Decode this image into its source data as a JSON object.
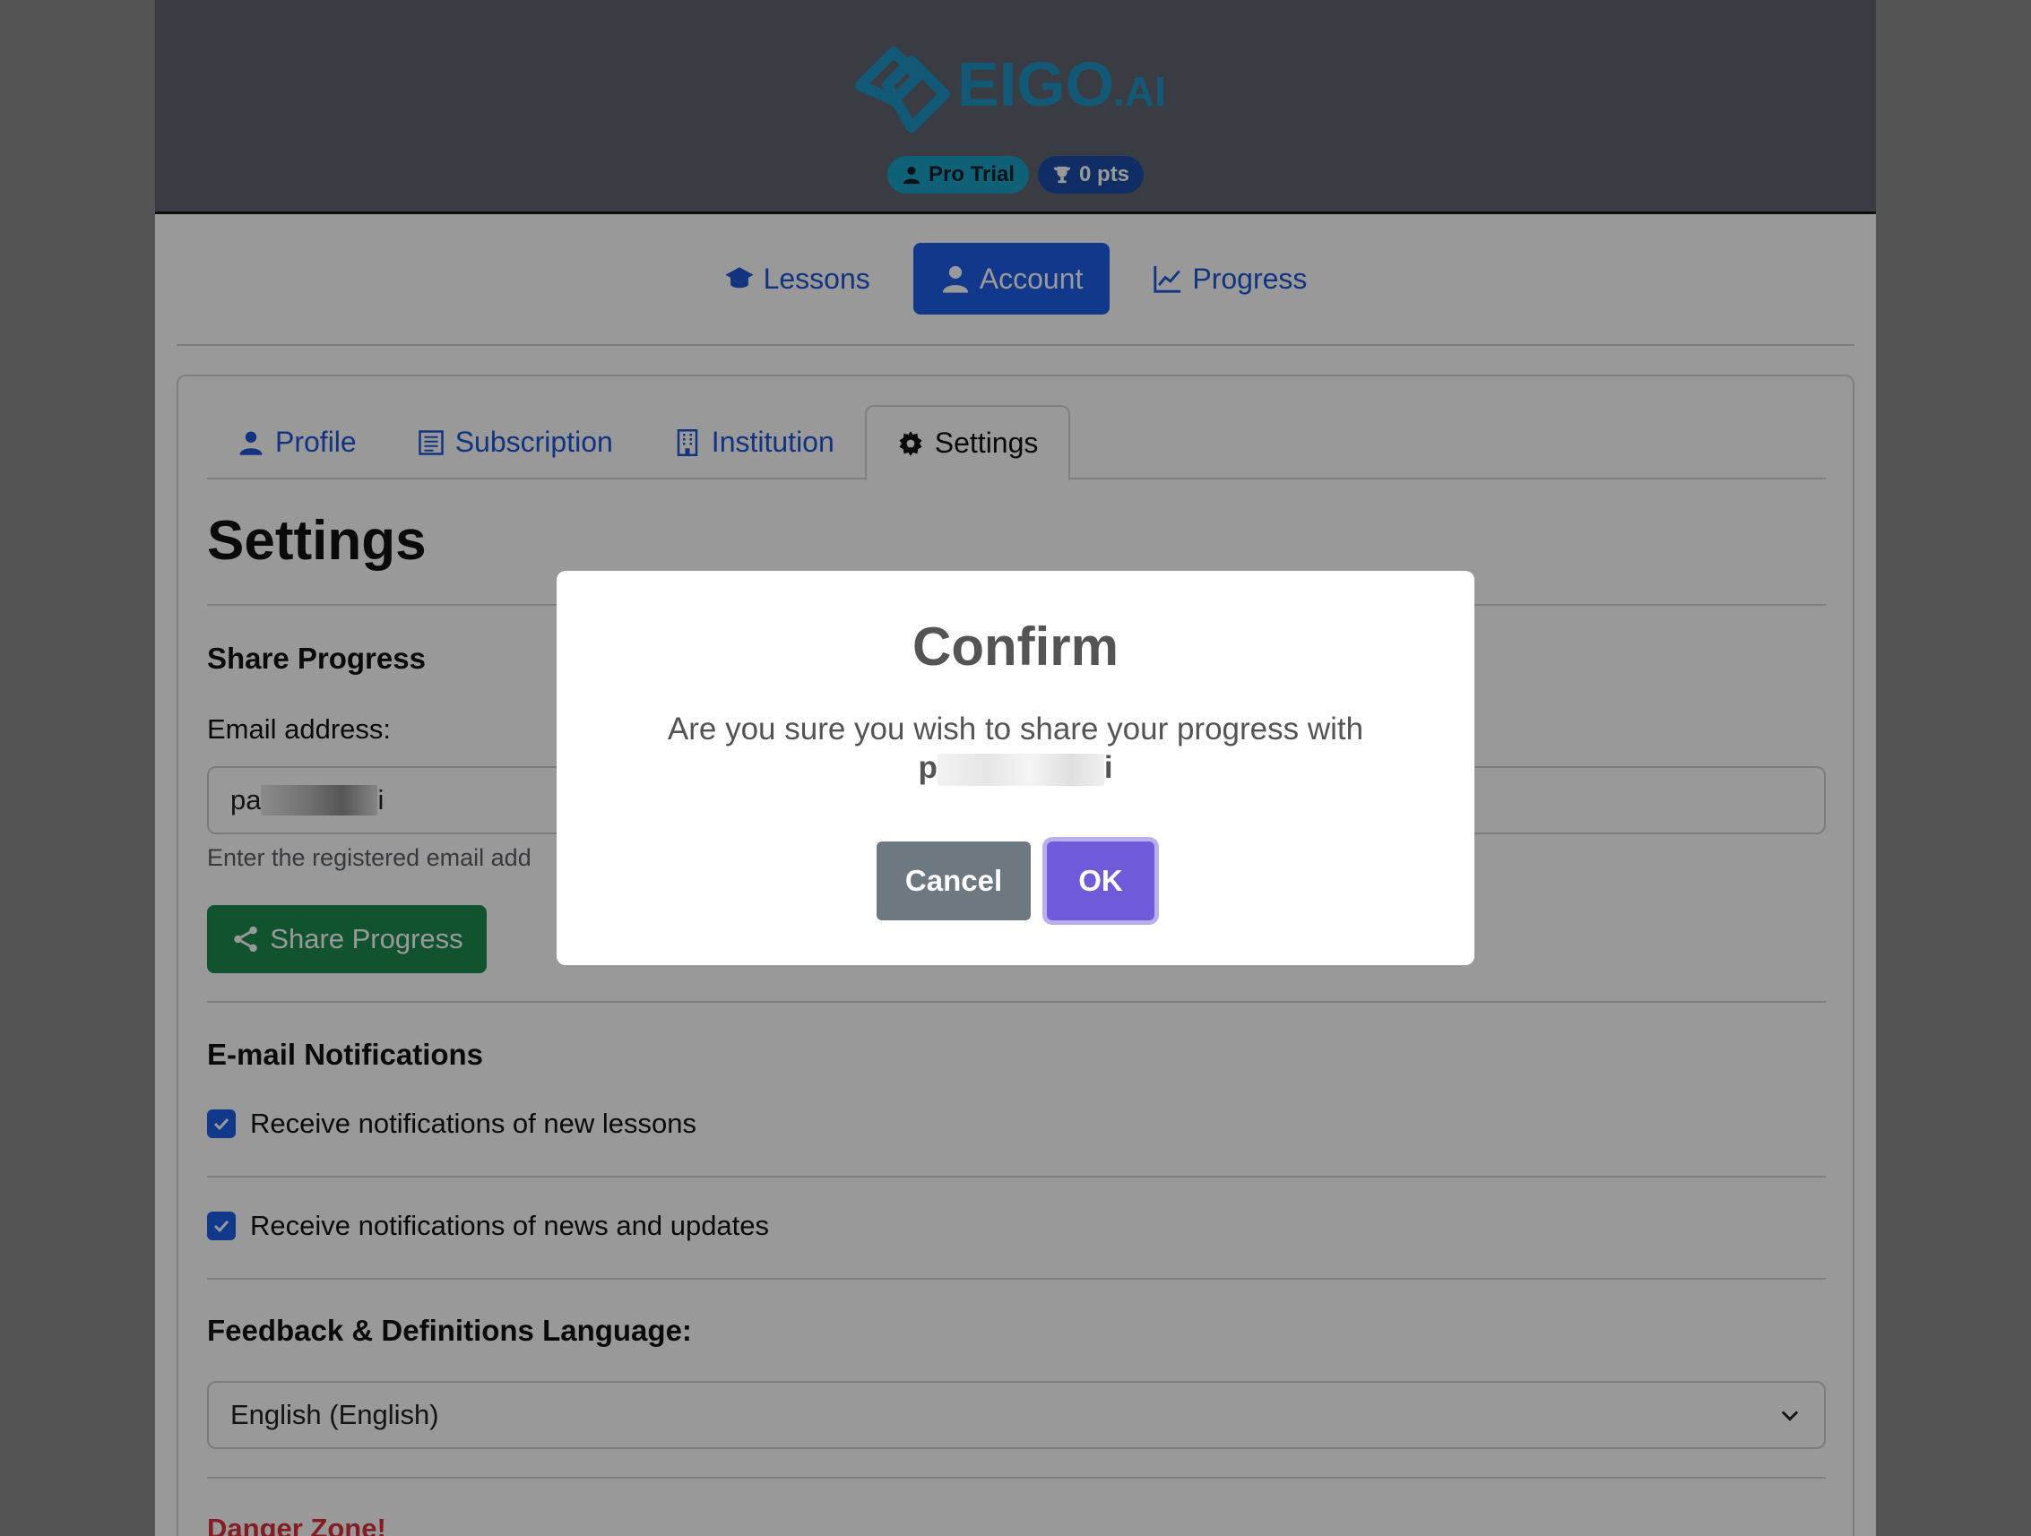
{
  "header": {
    "logo_text": "EIGO.AI",
    "badges": [
      {
        "label": "Pro Trial",
        "icon": "user-icon"
      },
      {
        "label": "0 pts",
        "icon": "trophy-icon"
      }
    ]
  },
  "main_nav": [
    {
      "label": "Lessons",
      "icon": "graduation-cap-icon",
      "active": false
    },
    {
      "label": "Account",
      "icon": "user-icon",
      "active": true
    },
    {
      "label": "Progress",
      "icon": "chart-line-icon",
      "active": false
    }
  ],
  "tabs": [
    {
      "label": "Profile",
      "icon": "user-icon",
      "active": false
    },
    {
      "label": "Subscription",
      "icon": "receipt-icon",
      "active": false
    },
    {
      "label": "Institution",
      "icon": "building-icon",
      "active": false
    },
    {
      "label": "Settings",
      "icon": "gear-icon",
      "active": true
    }
  ],
  "settings": {
    "title": "Settings",
    "share": {
      "title": "Share Progress",
      "email_label": "Email address:",
      "email_prefix": "pa",
      "email_suffix": "i",
      "help_text": "Enter the registered email add",
      "button_label": "Share Progress"
    },
    "notifications": {
      "title": "E-mail Notifications",
      "items": [
        {
          "label": "Receive notifications of new lessons",
          "checked": true
        },
        {
          "label": "Receive notifications of news and updates",
          "checked": true
        }
      ]
    },
    "language": {
      "title": "Feedback & Definitions Language:",
      "selected": "English (English)"
    },
    "danger_title": "Danger Zone!"
  },
  "modal": {
    "title": "Confirm",
    "text": "Are you sure you wish to share your progress with",
    "email_prefix": "p",
    "email_suffix": "i",
    "cancel_label": "Cancel",
    "ok_label": "OK"
  },
  "colors": {
    "primary": "#1e5ee8",
    "success": "#1b8a4e",
    "danger": "#dc2f3d",
    "ok_button": "#6f5ad9",
    "cancel_button": "#6e7881"
  }
}
